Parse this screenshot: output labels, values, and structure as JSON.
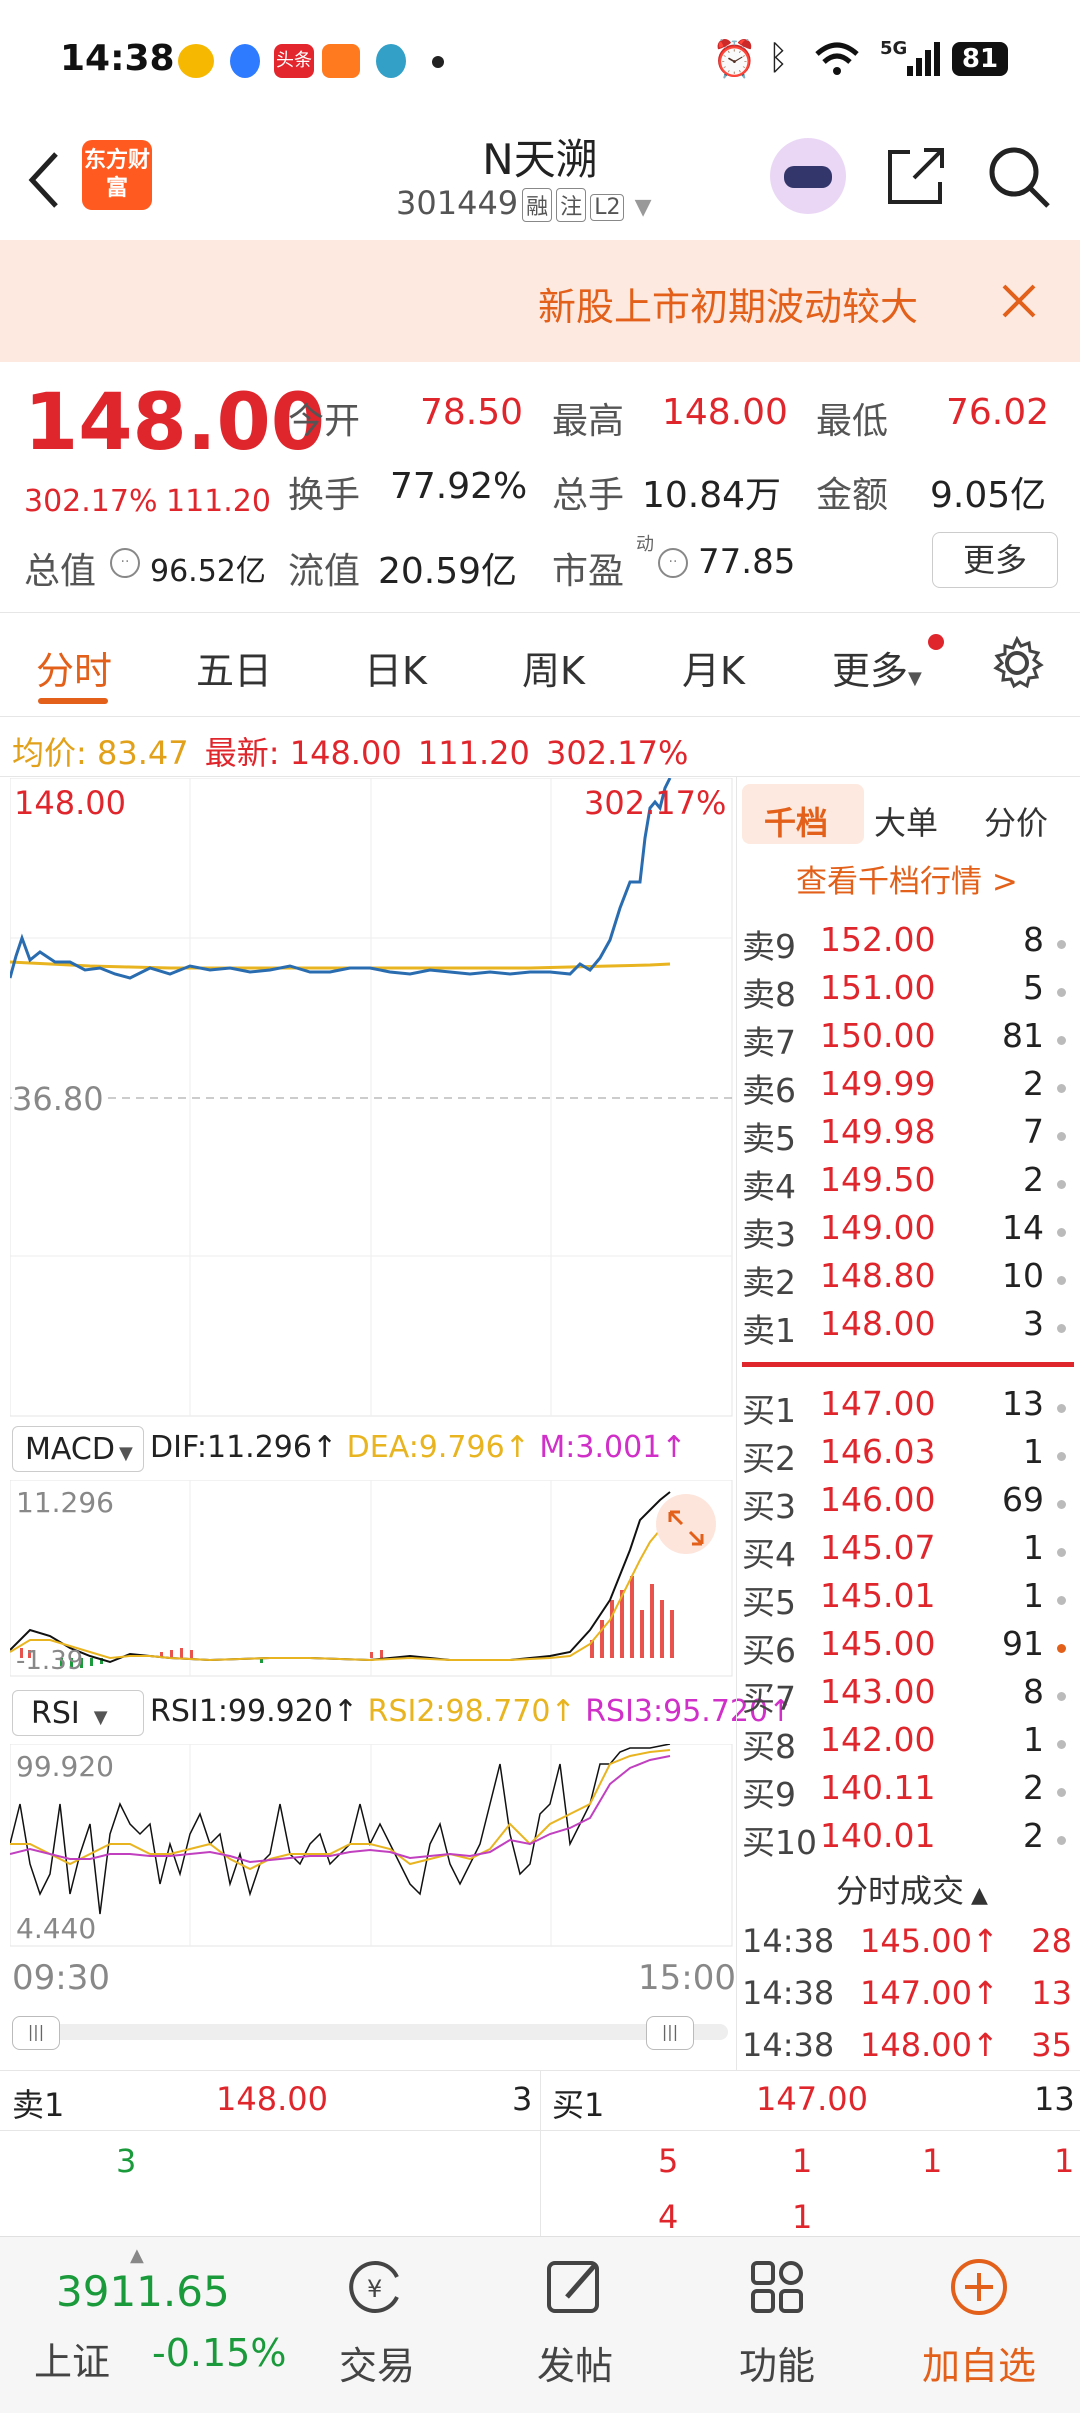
{
  "status_bar": {
    "time": "14:38",
    "left_icons": [
      "weibo-icon",
      "browser-icon",
      "toutiao-icon",
      "app-icon",
      "network-icon",
      "dot-icon"
    ],
    "toutiao_text": "头条",
    "network_label": "5G",
    "battery": "81"
  },
  "header": {
    "logo_text": "东方财富",
    "stock_name": "N天溯",
    "stock_code": "301449",
    "tags": [
      "融",
      "注",
      "L2"
    ]
  },
  "notice": {
    "text": "新股上市初期波动较大"
  },
  "quote": {
    "price": "148.00",
    "change_pct": "302.17%",
    "change_amt": "111.20",
    "open_label": "今开",
    "open": "78.50",
    "high_label": "最高",
    "high": "148.00",
    "low_label": "最低",
    "low": "76.02",
    "turnover_label": "换手",
    "turnover": "77.92%",
    "volume_label": "总手",
    "volume": "10.84万",
    "amount_label": "金额",
    "amount": "9.05亿",
    "mktcap_label": "总值",
    "mktcap": "96.52亿",
    "float_label": "流值",
    "float": "20.59亿",
    "pe_label": "市盈",
    "pe_sup": "动",
    "pe": "77.85",
    "more_button": "更多"
  },
  "tabs": [
    "分时",
    "五日",
    "日K",
    "周K",
    "月K",
    "更多"
  ],
  "chart_header": {
    "avg_label": "均价:",
    "avg": "83.47",
    "latest_label": "最新:",
    "latest": "148.00",
    "change": "111.20",
    "pct": "302.17%"
  },
  "intraday": {
    "top_left": "148.00",
    "top_right": "302.17%",
    "base_label": "36.80",
    "time_start": "09:30",
    "time_end": "15:00"
  },
  "macd": {
    "selector": "MACD",
    "dif": "DIF:11.296↑",
    "dea": "DEA:9.796↑",
    "m": "M:3.001↑",
    "top_value": "11.296",
    "bottom_value": "-1.39"
  },
  "rsi": {
    "selector": "RSI",
    "rsi1": "RSI1:99.920↑",
    "rsi2": "RSI2:98.770↑",
    "rsi3": "RSI3:95.720↑",
    "top_value": "99.920",
    "bottom_value": "4.440"
  },
  "orderbook": {
    "tabs": [
      "千档",
      "大单",
      "分价"
    ],
    "link": "查看千档行情 >",
    "sells": [
      {
        "label": "卖9",
        "price": "152.00",
        "vol": "8"
      },
      {
        "label": "卖8",
        "price": "151.00",
        "vol": "5"
      },
      {
        "label": "卖7",
        "price": "150.00",
        "vol": "81"
      },
      {
        "label": "卖6",
        "price": "149.99",
        "vol": "2"
      },
      {
        "label": "卖5",
        "price": "149.98",
        "vol": "7"
      },
      {
        "label": "卖4",
        "price": "149.50",
        "vol": "2"
      },
      {
        "label": "卖3",
        "price": "149.00",
        "vol": "14"
      },
      {
        "label": "卖2",
        "price": "148.80",
        "vol": "10"
      },
      {
        "label": "卖1",
        "price": "148.00",
        "vol": "3"
      }
    ],
    "buys": [
      {
        "label": "买1",
        "price": "147.00",
        "vol": "13"
      },
      {
        "label": "买2",
        "price": "146.03",
        "vol": "1"
      },
      {
        "label": "买3",
        "price": "146.00",
        "vol": "69"
      },
      {
        "label": "买4",
        "price": "145.07",
        "vol": "1"
      },
      {
        "label": "买5",
        "price": "145.01",
        "vol": "1"
      },
      {
        "label": "买6",
        "price": "145.00",
        "vol": "91"
      },
      {
        "label": "买7",
        "price": "143.00",
        "vol": "8"
      },
      {
        "label": "买8",
        "price": "142.00",
        "vol": "1"
      },
      {
        "label": "买9",
        "price": "140.11",
        "vol": "2"
      },
      {
        "label": "买10",
        "price": "140.01",
        "vol": "2"
      }
    ],
    "trades_title": "分时成交",
    "trades": [
      {
        "time": "14:38",
        "price": "145.00↑",
        "vol": "28"
      },
      {
        "time": "14:38",
        "price": "147.00↑",
        "vol": "13"
      },
      {
        "time": "14:38",
        "price": "148.00↑",
        "vol": "35"
      }
    ]
  },
  "queue": {
    "sell_label": "卖1",
    "sell_price": "148.00",
    "sell_vol": "3",
    "buy_label": "买1",
    "buy_price": "147.00",
    "buy_vol": "13",
    "sell_orders": [
      "3"
    ],
    "buy_orders_row1": [
      "5",
      "1",
      "1",
      "1"
    ],
    "buy_orders_row2": [
      "4",
      "1"
    ]
  },
  "bottom": {
    "index_value": "3911.65",
    "index_name": "上证",
    "index_change": "-0.15%",
    "nav": [
      "交易",
      "发帖",
      "功能",
      "加自选"
    ]
  }
}
